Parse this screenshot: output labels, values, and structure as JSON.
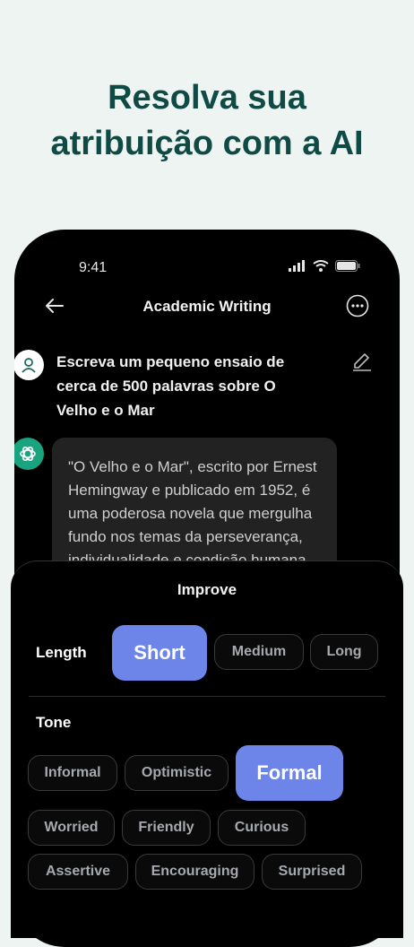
{
  "headline": {
    "line1": "Resolva sua",
    "line2": "atribuição com a AI"
  },
  "status_bar": {
    "time": "9:41"
  },
  "nav": {
    "title": "Academic Writing"
  },
  "chat": {
    "user_message": "Escreva um pequeno ensaio de cerca de 500 palavras sobre O Velho e o Mar",
    "ai_message": "\"O Velho e o Mar\", escrito por Ernest Hemingway e publicado em 1952, é uma poderosa novela que mergulha fundo nos temas da perseverança, individualidade e condição humana."
  },
  "improve": {
    "title": "Improve",
    "length_label": "Length",
    "length_options": [
      "Short",
      "Medium",
      "Long"
    ],
    "length_selected": "Short",
    "tone_label": "Tone",
    "tone_options": [
      "Informal",
      "Optimistic",
      "Formal",
      "Worried",
      "Friendly",
      "Curious",
      "Assertive",
      "Encouraging",
      "Surprised"
    ],
    "tone_selected": "Formal"
  },
  "colors": {
    "headline": "#0f4a45",
    "accent": "#6d84e8",
    "ai_avatar": "#19a37f",
    "background": "#edf4f1"
  }
}
